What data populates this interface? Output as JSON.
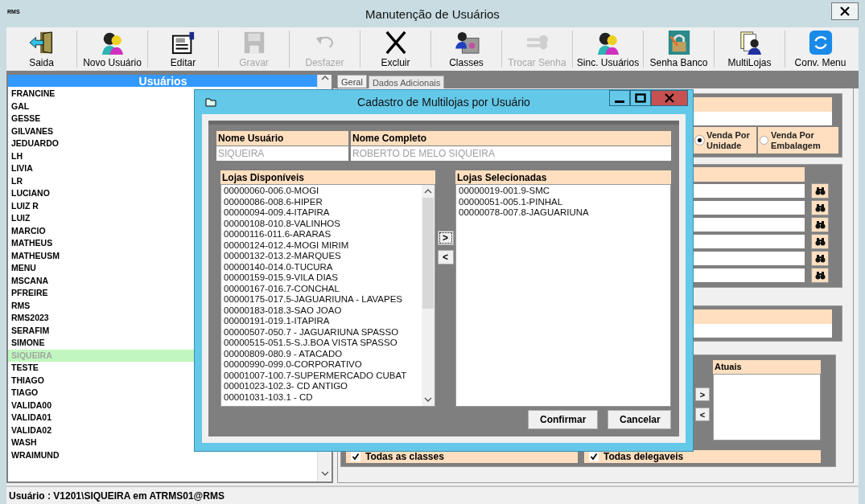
{
  "window": {
    "logo": "RMS",
    "title": "Manutenção de Usuários"
  },
  "toolbar": [
    {
      "label": "Saida",
      "disabled": false
    },
    {
      "label": "Novo Usuário",
      "disabled": false
    },
    {
      "label": "Editar",
      "disabled": false
    },
    {
      "label": "Gravar",
      "disabled": true
    },
    {
      "label": "Desfazer",
      "disabled": true
    },
    {
      "label": "Excluir",
      "disabled": false
    },
    {
      "label": "Classes",
      "disabled": false
    },
    {
      "label": "Trocar Senha",
      "disabled": true
    },
    {
      "label": "Sinc. Usuários",
      "disabled": false
    },
    {
      "label": "Senha Banco",
      "disabled": false
    },
    {
      "label": "MultiLojas",
      "disabled": false
    },
    {
      "label": "Conv. Menu",
      "disabled": false
    }
  ],
  "users_panel": {
    "title": "Usuários",
    "users": [
      {
        "name": "FRANCINE",
        "selected": false
      },
      {
        "name": "GAL",
        "selected": false
      },
      {
        "name": "GESSE",
        "selected": false
      },
      {
        "name": "GILVANES",
        "selected": false
      },
      {
        "name": "JEDUARDO",
        "selected": false
      },
      {
        "name": "LH",
        "selected": false
      },
      {
        "name": "LIVIA",
        "selected": false
      },
      {
        "name": "LR",
        "selected": false
      },
      {
        "name": "LUCIANO",
        "selected": false
      },
      {
        "name": "LUIZ R",
        "selected": false
      },
      {
        "name": "LUIZ",
        "selected": false
      },
      {
        "name": "MARCIO",
        "selected": false
      },
      {
        "name": "MATHEUS",
        "selected": false
      },
      {
        "name": "MATHEUSM",
        "selected": false
      },
      {
        "name": "MENU",
        "selected": false
      },
      {
        "name": "MSCANA",
        "selected": false
      },
      {
        "name": "PFREIRE",
        "selected": false
      },
      {
        "name": "RMS",
        "selected": false
      },
      {
        "name": "RMS2023",
        "selected": false
      },
      {
        "name": "SERAFIM",
        "selected": false
      },
      {
        "name": "SIMONE",
        "selected": false
      },
      {
        "name": "SIQUEIRA",
        "selected": true
      },
      {
        "name": "TESTE",
        "selected": false
      },
      {
        "name": "THIAGO",
        "selected": false
      },
      {
        "name": "TIAGO",
        "selected": false
      },
      {
        "name": "VALIDA00",
        "selected": false
      },
      {
        "name": "VALIDA01",
        "selected": false
      },
      {
        "name": "VALIDA02",
        "selected": false
      },
      {
        "name": "WASH",
        "selected": false
      },
      {
        "name": "WRAIMUND",
        "selected": false
      }
    ]
  },
  "tabs": [
    {
      "label": "Geral",
      "selected": true
    },
    {
      "label": "Dados Adicionais",
      "selected": false
    }
  ],
  "sale_options": [
    {
      "label": "Venda Por Unidade",
      "selected": true
    },
    {
      "label": "Venda Por Embalagem",
      "selected": false
    }
  ],
  "lookup_rows": [
    {
      "kind": "lookup"
    },
    {
      "kind": "lookup"
    },
    {
      "kind": "lookup"
    },
    {
      "kind": "lookup"
    },
    {
      "kind": "lookup"
    },
    {
      "kind": "lookup"
    }
  ],
  "transfer": {
    "list_title": "Atuais",
    "move_buttons": [
      ">",
      "<"
    ]
  },
  "checkboxes": [
    {
      "label": "Todas as classes",
      "checked": true
    },
    {
      "label": "Todas delegaveis",
      "checked": true
    }
  ],
  "dialog": {
    "title": "Cadastro de Multilojas por Usuário",
    "fields": [
      {
        "label": "Nome Usuário",
        "value": "SIQUEIRA"
      },
      {
        "label": "Nome Completo",
        "value": "ROBERTO DE MELO SIQUEIRA"
      }
    ],
    "available_title": "Lojas Disponíveis",
    "available": [
      "00000060-006.0-MOGI",
      "00000086-008.6-HIPER",
      "00000094-009.4-ITAPIRA",
      "00000108-010.8-VALINHOS",
      "00000116-011.6-ARARAS",
      "00000124-012.4-MOGI MIRIM",
      "00000132-013.2-MARQUES",
      "00000140-014.0-TUCURA",
      "00000159-015.9-VILA DIAS",
      "00000167-016.7-CONCHAL",
      "00000175-017.5-JAGUARIUNA - LAVAPES",
      "00000183-018.3-SAO JOAO",
      "00000191-019.1-ITAPIRA",
      "00000507-050.7 - JAGUARIUNA SPASSO",
      "00000515-051.5-S.J.BOA VISTA SPASSO",
      "00000809-080.9 - ATACADO",
      "00000990-099.0-CORPORATIVO",
      "00001007-100.7-SUPERMERCADO CUBAT",
      "00001023-102.3- CD ANTIGO",
      "00001031-103.1 - CD"
    ],
    "move_buttons": [
      ">",
      "<"
    ],
    "selected_title": "Lojas Selecionadas",
    "selected": [
      "00000019-001.9-SMC",
      "00000051-005.1-PINHAL",
      "00000078-007.8-JAGUARIUNA"
    ],
    "buttons": [
      "Confirmar",
      "Cancelar"
    ]
  },
  "status_bar": "Usuário : V1201\\SIQUEIRA em ATRMS01@RMS"
}
